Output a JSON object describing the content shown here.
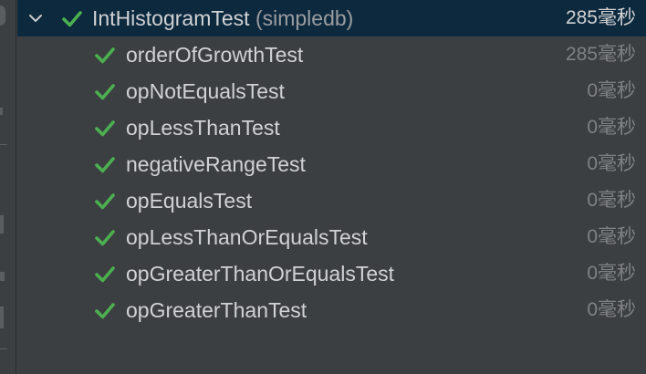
{
  "colors": {
    "background": "#3c3f41",
    "selected_row": "#0d293e",
    "check_green": "#4caf50",
    "text": "#d0d2d4",
    "muted_text": "#7f8284"
  },
  "suite": {
    "name": "IntHistogramTest",
    "package": "(simpledb)",
    "time": "285毫秒",
    "status_icon": "passed-check-icon",
    "expand_icon": "chevron-down-icon"
  },
  "tests": [
    {
      "name": "orderOfGrowthTest",
      "time": "285毫秒"
    },
    {
      "name": "opNotEqualsTest",
      "time": "0毫秒"
    },
    {
      "name": "opLessThanTest",
      "time": "0毫秒"
    },
    {
      "name": "negativeRangeTest",
      "time": "0毫秒"
    },
    {
      "name": "opEqualsTest",
      "time": "0毫秒"
    },
    {
      "name": "opLessThanOrEqualsTest",
      "time": "0毫秒"
    },
    {
      "name": "opGreaterThanOrEqualsTest",
      "time": "0毫秒"
    },
    {
      "name": "opGreaterThanTest",
      "time": "0毫秒"
    }
  ]
}
